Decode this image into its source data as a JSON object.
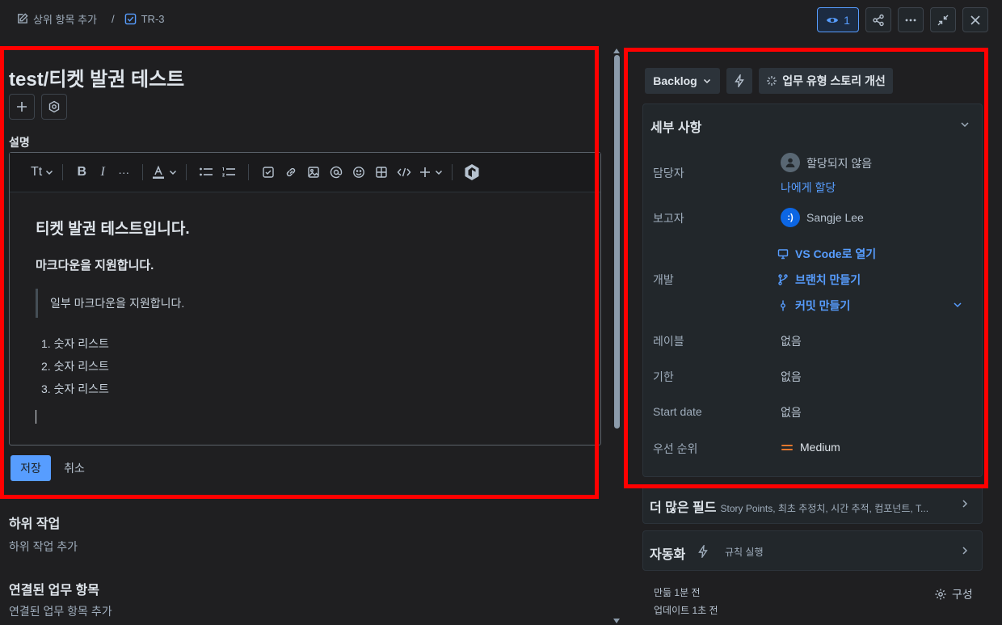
{
  "breadcrumb": {
    "parent_label": "상위 항목 추가",
    "separator": "/",
    "issue_key": "TR-3"
  },
  "top_actions": {
    "watch_count": "1"
  },
  "issue": {
    "title": "test/티켓 발권 테스트",
    "description_label": "설명"
  },
  "toolbar": {
    "text_style": "Tt",
    "more": "···"
  },
  "editor_content": {
    "heading1": "티켓 발권 테스트입니다.",
    "heading3": "마크다운을 지원합니다.",
    "quote": "일부 마크다운을 지원합니다.",
    "list": [
      "1. 숫자 리스트",
      "2. 숫자 리스트",
      "3. 숫자 리스트"
    ]
  },
  "editor_actions": {
    "save": "저장",
    "cancel": "취소"
  },
  "subtasks": {
    "title": "하위 작업",
    "add": "하위 작업 추가"
  },
  "linked": {
    "title": "연결된 업무 항목",
    "add": "연결된 업무 항목 추가"
  },
  "status": {
    "label": "Backlog",
    "improve_label": "업무 유형 스토리 개선"
  },
  "details": {
    "title": "세부 사항",
    "assignee_label": "담당자",
    "assignee_value": "할당되지 않음",
    "assign_to_me": "나에게 할당",
    "reporter_label": "보고자",
    "reporter_avatar": ":)",
    "reporter_value": "Sangje Lee",
    "dev_label": "개발",
    "dev_vscode": "VS Code로 열기",
    "dev_branch": "브랜치 만들기",
    "dev_commit": "커밋 만들기",
    "labels_label": "레이블",
    "labels_value": "없음",
    "due_label": "기한",
    "due_value": "없음",
    "start_label": "Start date",
    "start_value": "없음",
    "priority_label": "우선 순위",
    "priority_value": "Medium"
  },
  "more_fields": {
    "title": "더 많은 필드",
    "summary": "Story Points, 최초 추정치, 시간 추적, 컴포넌트, T..."
  },
  "automation": {
    "title": "자동화",
    "rule_label": "규칙 실행"
  },
  "footer": {
    "created": "만듦 1분 전",
    "updated": "업데이트 1초 전",
    "configure": "구성"
  },
  "colors": {
    "accent": "#579dff",
    "highlight_box": "#ff0000",
    "priority_medium": "#e2762d"
  }
}
